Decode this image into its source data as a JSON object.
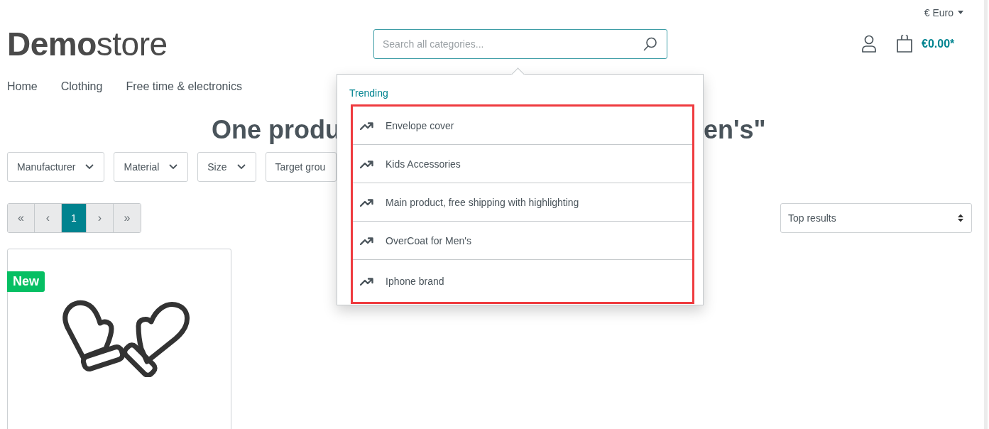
{
  "currency": {
    "label": "€ Euro"
  },
  "logo": {
    "bold": "Demo",
    "light": "store"
  },
  "search": {
    "placeholder": "Search all categories..."
  },
  "cart": {
    "total": "€0.00*"
  },
  "nav": [
    {
      "label": "Home"
    },
    {
      "label": "Clothing"
    },
    {
      "label": "Free time & electronics"
    }
  ],
  "heading": {
    "visible_start": "One produ",
    "visible_end": "en's\""
  },
  "filters": [
    {
      "label": "Manufacturer"
    },
    {
      "label": "Material"
    },
    {
      "label": "Size"
    },
    {
      "label": "Target grou"
    }
  ],
  "pagination": [
    {
      "label": "«",
      "selected": false
    },
    {
      "label": "‹",
      "selected": false
    },
    {
      "label": "1",
      "selected": true
    },
    {
      "label": "›",
      "selected": false
    },
    {
      "label": "»",
      "selected": false
    }
  ],
  "sort": {
    "value": "Top results"
  },
  "product": {
    "badge": "New"
  },
  "suggestions": {
    "title": "Trending",
    "highlighted": true,
    "items": [
      {
        "label": "Envelope cover"
      },
      {
        "label": "Kids Accessories"
      },
      {
        "label": "Main product, free shipping with highlighting"
      },
      {
        "label": "OverCoat for Men's"
      },
      {
        "label": "Iphone brand"
      }
    ]
  }
}
